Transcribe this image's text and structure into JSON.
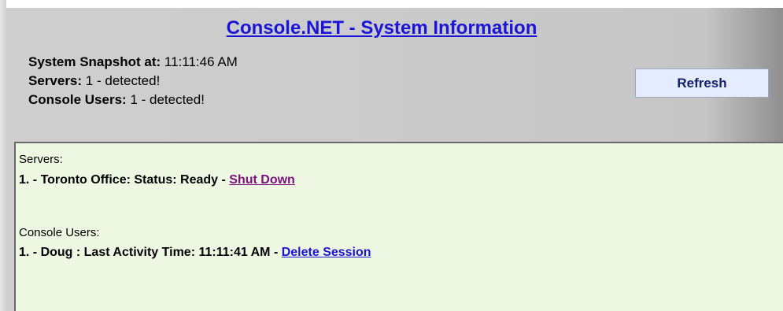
{
  "title": "Console.NET - System Information",
  "summary": {
    "snapshot_label": "System Snapshot at:",
    "snapshot_value": "11:11:46 AM",
    "servers_label": "Servers:",
    "servers_value": "1 - detected!",
    "users_label": "Console Users:",
    "users_value": "1 - detected!"
  },
  "refresh_label": "Refresh",
  "panel": {
    "servers_heading": "Servers:",
    "servers": [
      {
        "text": "1. - Toronto Office: Status: Ready - ",
        "action": "Shut Down"
      }
    ],
    "users_heading": "Console Users:",
    "users": [
      {
        "text": "1. - Doug : Last Activity Time: 11:11:41 AM - ",
        "action": "Delete Session"
      }
    ]
  },
  "colors": {
    "link": "#1a14d9",
    "visited_link": "#7b0f7b",
    "panel_bg": "#eef7e2",
    "frame_bg": "#cccccc"
  }
}
